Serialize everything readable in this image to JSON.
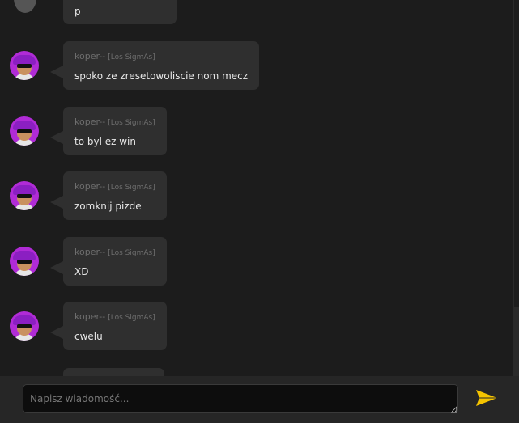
{
  "messages": [
    {
      "author": "koper--",
      "tag": "[Los SigmAs]",
      "text": "spoko ze zresetowoliscie nom mecz"
    },
    {
      "author": "koper--",
      "tag": "[Los SigmAs]",
      "text": "to byl ez win"
    },
    {
      "author": "koper--",
      "tag": "[Los SigmAs]",
      "text": "zomknij pizde"
    },
    {
      "author": "koper--",
      "tag": "[Los SigmAs]",
      "text": "XD"
    },
    {
      "author": "koper--",
      "tag": "[Los SigmAs]",
      "text": "cwelu"
    }
  ],
  "partial_top_text": "p",
  "composer": {
    "placeholder": "Napisz wiadomość..."
  },
  "colors": {
    "accent": "#f5c400",
    "avatar": "#b02bd6",
    "bubble": "#2f2f2f",
    "background": "#1c1c1c"
  },
  "icons": {
    "send": "send-arrow-icon",
    "avatar": "user-avatar-icon",
    "resize": "resize-handle-icon"
  }
}
